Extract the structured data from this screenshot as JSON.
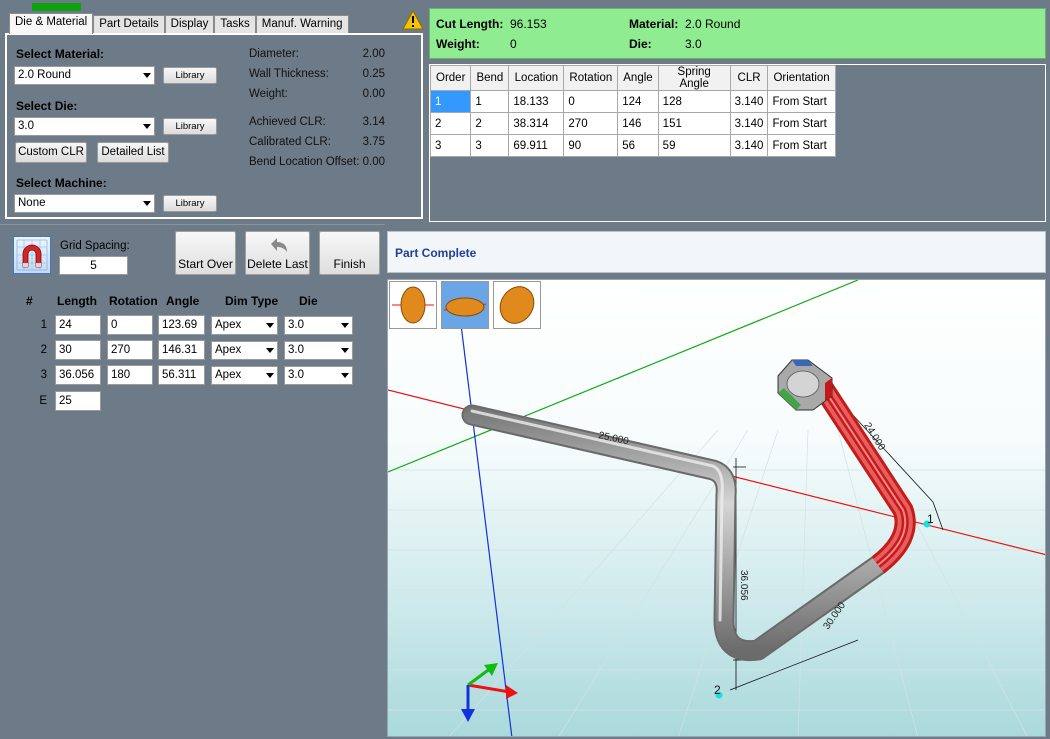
{
  "tabs": [
    "Die & Material",
    "Part Details",
    "Display",
    "Tasks",
    "Manuf. Warning"
  ],
  "material_panel": {
    "select_material_label": "Select Material:",
    "material_value": "2.0 Round",
    "select_die_label": "Select Die:",
    "die_value": "3.0",
    "select_machine_label": "Select Machine:",
    "machine_value": "None",
    "library_label": "Library",
    "custom_clr_label": "Custom CLR",
    "detailed_list_label": "Detailed List",
    "properties": [
      {
        "name": "Diameter:",
        "value": "2.00"
      },
      {
        "name": "Wall Thickness:",
        "value": "0.25"
      },
      {
        "name": "Weight:",
        "value": "0.00"
      },
      {
        "name": "Achieved CLR:",
        "value": "3.14"
      },
      {
        "name": "Calibrated CLR:",
        "value": "3.75"
      },
      {
        "name": "Bend Location Offset:",
        "value": "0.00"
      }
    ]
  },
  "summary": {
    "cut_length_label": "Cut Length:",
    "cut_length_value": "96.153",
    "weight_label": "Weight:",
    "weight_value": "0",
    "material_label": "Material:",
    "material_value": "2.0 Round",
    "die_label": "Die:",
    "die_value": "3.0",
    "color": "#90ec90"
  },
  "bend_table": {
    "columns": [
      "Order",
      "Bend",
      "Location",
      "Rotation",
      "Angle",
      "Spring Angle",
      "CLR",
      "Orientation"
    ],
    "rows": [
      [
        "1",
        "1",
        "18.133",
        "0",
        "124",
        "128",
        "3.140",
        "From Start"
      ],
      [
        "2",
        "2",
        "38.314",
        "270",
        "146",
        "151",
        "3.140",
        "From Start"
      ],
      [
        "3",
        "3",
        "69.911",
        "90",
        "56",
        "59",
        "3.140",
        "From Start"
      ]
    ]
  },
  "editor": {
    "grid_spacing_label": "Grid Spacing:",
    "grid_spacing_value": "5",
    "start_over_label": "Start Over",
    "delete_last_label": "Delete Last",
    "finish_label": "Finish",
    "headers": [
      "#",
      "Length",
      "Rotation",
      "Angle",
      "Dim Type",
      "Die"
    ],
    "rows": [
      {
        "num": "1",
        "length": "24",
        "rotation": "0",
        "angle": "123.69",
        "dim_type": "Apex",
        "die": "3.0"
      },
      {
        "num": "2",
        "length": "30",
        "rotation": "270",
        "angle": "146.31",
        "dim_type": "Apex",
        "die": "3.0"
      },
      {
        "num": "3",
        "length": "36.056",
        "rotation": "180",
        "angle": "56.311",
        "dim_type": "Apex",
        "die": "3.0"
      }
    ],
    "end_label": "E",
    "end_value": "25"
  },
  "viewer": {
    "status": "Part Complete",
    "dimensions": [
      "25.000",
      "24.000",
      "36.056",
      "30.000"
    ],
    "markers": [
      "2",
      "1"
    ],
    "axis_colors": {
      "x": "#ee1111",
      "y": "#11aa11",
      "z": "#1133dd"
    }
  }
}
